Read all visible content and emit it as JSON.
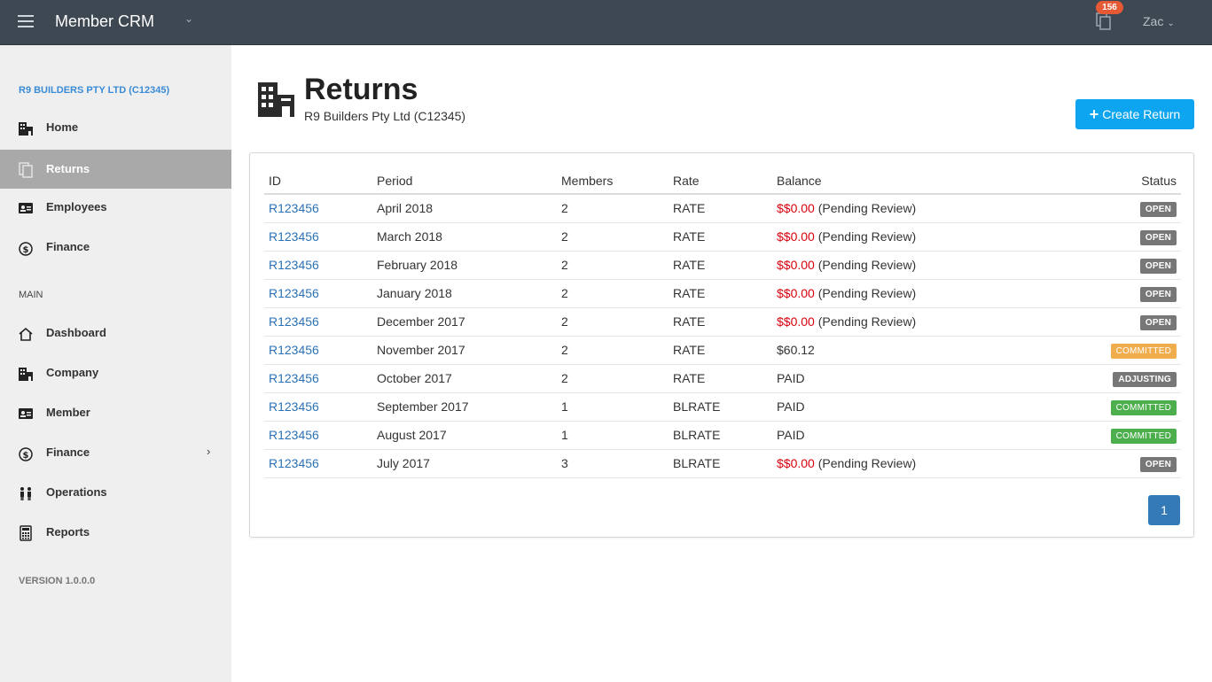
{
  "header": {
    "app_title": "Member CRM",
    "notification_count": "156",
    "user_name": "Zac"
  },
  "sidebar": {
    "company_title": "R9 BUILDERS PTY LTD (C12345)",
    "company_items": [
      {
        "label": "Home",
        "icon": "building-icon"
      },
      {
        "label": "Returns",
        "icon": "documents-icon",
        "active": true
      },
      {
        "label": "Employees",
        "icon": "id-card-icon"
      },
      {
        "label": "Finance",
        "icon": "dollar-icon"
      }
    ],
    "main_section_label": "MAIN",
    "main_items": [
      {
        "label": "Dashboard",
        "icon": "home-icon"
      },
      {
        "label": "Company",
        "icon": "building-icon"
      },
      {
        "label": "Member",
        "icon": "id-card-icon"
      },
      {
        "label": "Finance",
        "icon": "dollar-icon",
        "has_submenu": true
      },
      {
        "label": "Operations",
        "icon": "people-icon"
      },
      {
        "label": "Reports",
        "icon": "calculator-icon"
      }
    ],
    "version": "VERSION 1.0.0.0"
  },
  "page": {
    "title": "Returns",
    "subtitle": "R9 Builders Pty Ltd (C12345)",
    "create_button": "Create Return"
  },
  "table": {
    "columns": [
      "ID",
      "Period",
      "Members",
      "Rate",
      "Balance",
      "Status"
    ],
    "rows": [
      {
        "id": "R123456",
        "period": "April 2018",
        "members": "2",
        "rate": "RATE",
        "balance_amount": "$$0.00",
        "balance_note": " (Pending Review)",
        "status": "OPEN",
        "status_style": "OPEN"
      },
      {
        "id": "R123456",
        "period": "March 2018",
        "members": "2",
        "rate": "RATE",
        "balance_amount": "$$0.00",
        "balance_note": " (Pending Review)",
        "status": "OPEN",
        "status_style": "OPEN"
      },
      {
        "id": "R123456",
        "period": "February 2018",
        "members": "2",
        "rate": "RATE",
        "balance_amount": "$$0.00",
        "balance_note": " (Pending Review)",
        "status": "OPEN",
        "status_style": "OPEN"
      },
      {
        "id": "R123456",
        "period": "January 2018",
        "members": "2",
        "rate": "RATE",
        "balance_amount": "$$0.00",
        "balance_note": " (Pending Review)",
        "status": "OPEN",
        "status_style": "OPEN"
      },
      {
        "id": "R123456",
        "period": "December 2017",
        "members": "2",
        "rate": "RATE",
        "balance_amount": "$$0.00",
        "balance_note": " (Pending Review)",
        "status": "OPEN",
        "status_style": "OPEN"
      },
      {
        "id": "R123456",
        "period": "November 2017",
        "members": "2",
        "rate": "RATE",
        "balance_amount": "",
        "balance_note": "$60.12",
        "status": "COMMITTED",
        "status_style": "COMMITTED-o"
      },
      {
        "id": "R123456",
        "period": "October 2017",
        "members": "2",
        "rate": "RATE",
        "balance_amount": "",
        "balance_note": "PAID",
        "status": "ADJUSTING",
        "status_style": "ADJUSTING"
      },
      {
        "id": "R123456",
        "period": "September 2017",
        "members": "1",
        "rate": "BLRATE",
        "balance_amount": "",
        "balance_note": "PAID",
        "status": "COMMITTED",
        "status_style": "COMMITTED-g"
      },
      {
        "id": "R123456",
        "period": "August 2017",
        "members": "1",
        "rate": "BLRATE",
        "balance_amount": "",
        "balance_note": "PAID",
        "status": "COMMITTED",
        "status_style": "COMMITTED-g"
      },
      {
        "id": "R123456",
        "period": "July 2017",
        "members": "3",
        "rate": "BLRATE",
        "balance_amount": "$$0.00",
        "balance_note": " (Pending Review)",
        "status": "OPEN",
        "status_style": "OPEN"
      }
    ]
  },
  "pagination": {
    "current_page": "1"
  },
  "colors": {
    "topbar": "#3d4852",
    "accent": "#0ea5f0",
    "link": "#2a72b5",
    "negative": "#d9000d",
    "committed_orange": "#f0ad4e",
    "committed_green": "#4cae4c"
  }
}
